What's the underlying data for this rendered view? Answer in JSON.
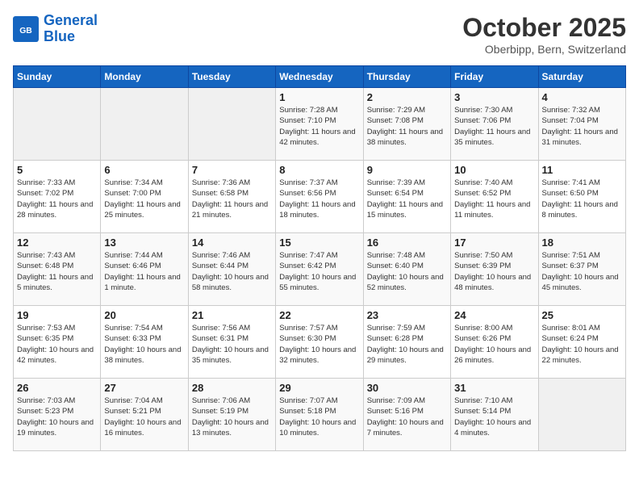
{
  "header": {
    "logo_line1": "General",
    "logo_line2": "Blue",
    "month": "October 2025",
    "location": "Oberbipp, Bern, Switzerland"
  },
  "days_of_week": [
    "Sunday",
    "Monday",
    "Tuesday",
    "Wednesday",
    "Thursday",
    "Friday",
    "Saturday"
  ],
  "weeks": [
    [
      {
        "day": "",
        "empty": true
      },
      {
        "day": "",
        "empty": true
      },
      {
        "day": "",
        "empty": true
      },
      {
        "day": "1",
        "sunrise": "Sunrise: 7:28 AM",
        "sunset": "Sunset: 7:10 PM",
        "daylight": "Daylight: 11 hours and 42 minutes."
      },
      {
        "day": "2",
        "sunrise": "Sunrise: 7:29 AM",
        "sunset": "Sunset: 7:08 PM",
        "daylight": "Daylight: 11 hours and 38 minutes."
      },
      {
        "day": "3",
        "sunrise": "Sunrise: 7:30 AM",
        "sunset": "Sunset: 7:06 PM",
        "daylight": "Daylight: 11 hours and 35 minutes."
      },
      {
        "day": "4",
        "sunrise": "Sunrise: 7:32 AM",
        "sunset": "Sunset: 7:04 PM",
        "daylight": "Daylight: 11 hours and 31 minutes."
      }
    ],
    [
      {
        "day": "5",
        "sunrise": "Sunrise: 7:33 AM",
        "sunset": "Sunset: 7:02 PM",
        "daylight": "Daylight: 11 hours and 28 minutes."
      },
      {
        "day": "6",
        "sunrise": "Sunrise: 7:34 AM",
        "sunset": "Sunset: 7:00 PM",
        "daylight": "Daylight: 11 hours and 25 minutes."
      },
      {
        "day": "7",
        "sunrise": "Sunrise: 7:36 AM",
        "sunset": "Sunset: 6:58 PM",
        "daylight": "Daylight: 11 hours and 21 minutes."
      },
      {
        "day": "8",
        "sunrise": "Sunrise: 7:37 AM",
        "sunset": "Sunset: 6:56 PM",
        "daylight": "Daylight: 11 hours and 18 minutes."
      },
      {
        "day": "9",
        "sunrise": "Sunrise: 7:39 AM",
        "sunset": "Sunset: 6:54 PM",
        "daylight": "Daylight: 11 hours and 15 minutes."
      },
      {
        "day": "10",
        "sunrise": "Sunrise: 7:40 AM",
        "sunset": "Sunset: 6:52 PM",
        "daylight": "Daylight: 11 hours and 11 minutes."
      },
      {
        "day": "11",
        "sunrise": "Sunrise: 7:41 AM",
        "sunset": "Sunset: 6:50 PM",
        "daylight": "Daylight: 11 hours and 8 minutes."
      }
    ],
    [
      {
        "day": "12",
        "sunrise": "Sunrise: 7:43 AM",
        "sunset": "Sunset: 6:48 PM",
        "daylight": "Daylight: 11 hours and 5 minutes."
      },
      {
        "day": "13",
        "sunrise": "Sunrise: 7:44 AM",
        "sunset": "Sunset: 6:46 PM",
        "daylight": "Daylight: 11 hours and 1 minute."
      },
      {
        "day": "14",
        "sunrise": "Sunrise: 7:46 AM",
        "sunset": "Sunset: 6:44 PM",
        "daylight": "Daylight: 10 hours and 58 minutes."
      },
      {
        "day": "15",
        "sunrise": "Sunrise: 7:47 AM",
        "sunset": "Sunset: 6:42 PM",
        "daylight": "Daylight: 10 hours and 55 minutes."
      },
      {
        "day": "16",
        "sunrise": "Sunrise: 7:48 AM",
        "sunset": "Sunset: 6:40 PM",
        "daylight": "Daylight: 10 hours and 52 minutes."
      },
      {
        "day": "17",
        "sunrise": "Sunrise: 7:50 AM",
        "sunset": "Sunset: 6:39 PM",
        "daylight": "Daylight: 10 hours and 48 minutes."
      },
      {
        "day": "18",
        "sunrise": "Sunrise: 7:51 AM",
        "sunset": "Sunset: 6:37 PM",
        "daylight": "Daylight: 10 hours and 45 minutes."
      }
    ],
    [
      {
        "day": "19",
        "sunrise": "Sunrise: 7:53 AM",
        "sunset": "Sunset: 6:35 PM",
        "daylight": "Daylight: 10 hours and 42 minutes."
      },
      {
        "day": "20",
        "sunrise": "Sunrise: 7:54 AM",
        "sunset": "Sunset: 6:33 PM",
        "daylight": "Daylight: 10 hours and 38 minutes."
      },
      {
        "day": "21",
        "sunrise": "Sunrise: 7:56 AM",
        "sunset": "Sunset: 6:31 PM",
        "daylight": "Daylight: 10 hours and 35 minutes."
      },
      {
        "day": "22",
        "sunrise": "Sunrise: 7:57 AM",
        "sunset": "Sunset: 6:30 PM",
        "daylight": "Daylight: 10 hours and 32 minutes."
      },
      {
        "day": "23",
        "sunrise": "Sunrise: 7:59 AM",
        "sunset": "Sunset: 6:28 PM",
        "daylight": "Daylight: 10 hours and 29 minutes."
      },
      {
        "day": "24",
        "sunrise": "Sunrise: 8:00 AM",
        "sunset": "Sunset: 6:26 PM",
        "daylight": "Daylight: 10 hours and 26 minutes."
      },
      {
        "day": "25",
        "sunrise": "Sunrise: 8:01 AM",
        "sunset": "Sunset: 6:24 PM",
        "daylight": "Daylight: 10 hours and 22 minutes."
      }
    ],
    [
      {
        "day": "26",
        "sunrise": "Sunrise: 7:03 AM",
        "sunset": "Sunset: 5:23 PM",
        "daylight": "Daylight: 10 hours and 19 minutes."
      },
      {
        "day": "27",
        "sunrise": "Sunrise: 7:04 AM",
        "sunset": "Sunset: 5:21 PM",
        "daylight": "Daylight: 10 hours and 16 minutes."
      },
      {
        "day": "28",
        "sunrise": "Sunrise: 7:06 AM",
        "sunset": "Sunset: 5:19 PM",
        "daylight": "Daylight: 10 hours and 13 minutes."
      },
      {
        "day": "29",
        "sunrise": "Sunrise: 7:07 AM",
        "sunset": "Sunset: 5:18 PM",
        "daylight": "Daylight: 10 hours and 10 minutes."
      },
      {
        "day": "30",
        "sunrise": "Sunrise: 7:09 AM",
        "sunset": "Sunset: 5:16 PM",
        "daylight": "Daylight: 10 hours and 7 minutes."
      },
      {
        "day": "31",
        "sunrise": "Sunrise: 7:10 AM",
        "sunset": "Sunset: 5:14 PM",
        "daylight": "Daylight: 10 hours and 4 minutes."
      },
      {
        "day": "",
        "empty": true
      }
    ]
  ]
}
